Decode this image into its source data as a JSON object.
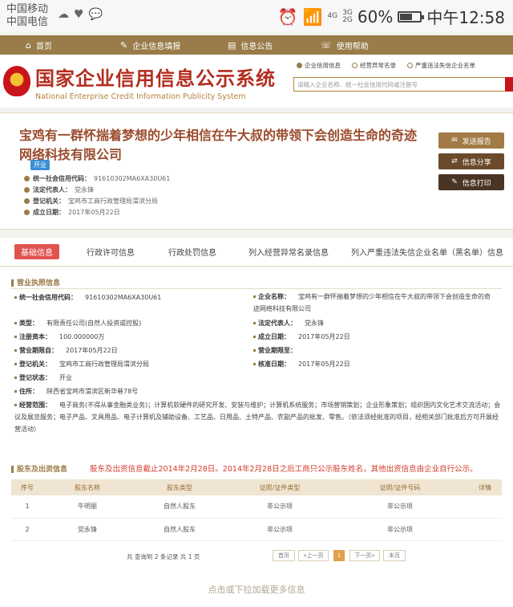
{
  "status": {
    "carrier1": "中国移动",
    "carrier2": "中国电信",
    "net1": "4G",
    "net2a": "3G",
    "net2b": "2G",
    "battery_pct": "60%",
    "battery_level": 0.6,
    "time": "中午12:58"
  },
  "topnav": {
    "items": [
      {
        "label": "首页",
        "icon": "home-icon"
      },
      {
        "label": "企业信息填报",
        "icon": "edit-icon"
      },
      {
        "label": "信息公告",
        "icon": "notice-icon"
      },
      {
        "label": "使用帮助",
        "icon": "help-icon"
      }
    ]
  },
  "header": {
    "title_cn": "国家企业信用信息公示系统",
    "title_en": "National Enterprise Credit Information Publicity System",
    "radios": [
      "企业信用信息",
      "经营异常名录",
      "严重违法失信企业名单"
    ],
    "search_placeholder": "请输入企业名称、统一社会信用代码或注册号"
  },
  "company": {
    "name": "宝鸡有一群怀揣着梦想的少年相信在牛大叔的带领下会创造生命的奇迹网络科技有限公司",
    "status_tag": "开业",
    "credit_code_label": "统一社会信用代码：",
    "credit_code": "91610302MA6XA30U61",
    "legal_rep_label": "法定代表人：",
    "legal_rep": "党永锋",
    "reg_authority_label": "登记机关：",
    "reg_authority": "宝鸡市工商行政管理局渭滨分局",
    "est_date_label": "成立日期：",
    "est_date": "2017年05月22日",
    "buttons": [
      "发送报告",
      "信息分享",
      "信息打印"
    ]
  },
  "tabs": [
    "基础信息",
    "行政许可信息",
    "行政处罚信息",
    "列入经营异常名录信息",
    "列入严重违法失信企业名单（黑名单）信息"
  ],
  "license": {
    "section_title": "营业执照信息",
    "rows": {
      "credit_code": {
        "label": "统一社会信用代码：",
        "value": "91610302MA6XA30U61"
      },
      "company_name": {
        "label": "企业名称：",
        "value": "宝鸡有一群怀揣着梦想的少年相信在牛大叔的带领下会创造生命的奇迹网络科技有限公司"
      },
      "type": {
        "label": "类型：",
        "value": "有限责任公司(自然人投资或控股)"
      },
      "legal_rep": {
        "label": "法定代表人：",
        "value": "党永锋"
      },
      "capital": {
        "label": "注册资本：",
        "value": "100.000000万"
      },
      "est_date": {
        "label": "成立日期：",
        "value": "2017年05月22日"
      },
      "term_from": {
        "label": "营业期限自：",
        "value": "2017年05月22日"
      },
      "term_to": {
        "label": "营业期限至：",
        "value": ""
      },
      "authority": {
        "label": "登记机关：",
        "value": "宝鸡市工商行政管理局渭滨分局"
      },
      "approve_date": {
        "label": "核准日期：",
        "value": "2017年05月22日"
      },
      "reg_status": {
        "label": "登记状态：",
        "value": "开业"
      },
      "address": {
        "label": "住所：",
        "value": "陕西省宝鸡市渭滨区新华巷78号"
      },
      "scope": {
        "label": "经营范围：",
        "value": "电子商务(不得从事金融类业务)；计算机软硬件的研究开发、安装与维护；计算机系统服务；市场营销策划；企业形象策划；组织国内文化艺术交流活动；会议及展览服务；电子产品、文具用品、电子计算机及辅助设备、工艺品、日用品、土特产品、农副产品的批发、零售。（依法须经批准的项目，经相关部门批准后方可开展经营活动）"
      }
    }
  },
  "shareholders": {
    "section_title": "股东及出资信息",
    "notice": "股东及出资信息截止2014年2月28日。2014年2月28日之后工商只公示股东姓名，其他出资信息由企业自行公示。",
    "headers": [
      "序号",
      "股东名称",
      "股东类型",
      "证照/证件类型",
      "证照/证件号码",
      "详情"
    ],
    "rows": [
      [
        "1",
        "牛明丽",
        "自然人股东",
        "非公示项",
        "非公示项",
        ""
      ],
      [
        "2",
        "党永锋",
        "自然人股东",
        "非公示项",
        "非公示项",
        ""
      ]
    ],
    "pager_info": "共 查询到 2 条记录 共 1 页",
    "pager": {
      "first": "首页",
      "prev": "«上一页",
      "current": "1",
      "next": "下一页»",
      "last": "末页"
    }
  },
  "load_more": "点击或下拉加载更多信息",
  "colors": {
    "brown": "#9a7c4a",
    "red": "#b32d1f",
    "notice": "#d23a2a"
  }
}
